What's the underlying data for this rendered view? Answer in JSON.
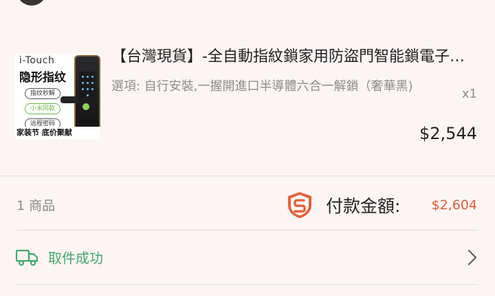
{
  "product": {
    "thumbnail": {
      "brand": "i-Touch",
      "headline": "隐形指纹",
      "tags": [
        "指纹秒解",
        "小米同款",
        "远程密码"
      ],
      "footer": "家装节 底价聚献"
    },
    "title": "【台灣現貨】-全自動指紋鎖家用防盜門智能鎖電子鎖密碼鎖",
    "variant": "選項: 自行安裝,一握開進口半導體六合一解鎖（奢華黑)",
    "quantity": "x1",
    "price": "$2,544"
  },
  "summary": {
    "item_count": "1 商品",
    "payment_label": "付款金額:",
    "payment_amount": "$2,604",
    "shield_icon": "shield-s-icon"
  },
  "pickup": {
    "status_label": "取件成功",
    "truck_icon": "truck-icon",
    "chevron_icon": "chevron-right-icon"
  },
  "colors": {
    "background": "#fdf5f4",
    "accent_price": "#e05a36",
    "success_green": "#3fa86b",
    "muted_text": "#8d8d8d"
  }
}
